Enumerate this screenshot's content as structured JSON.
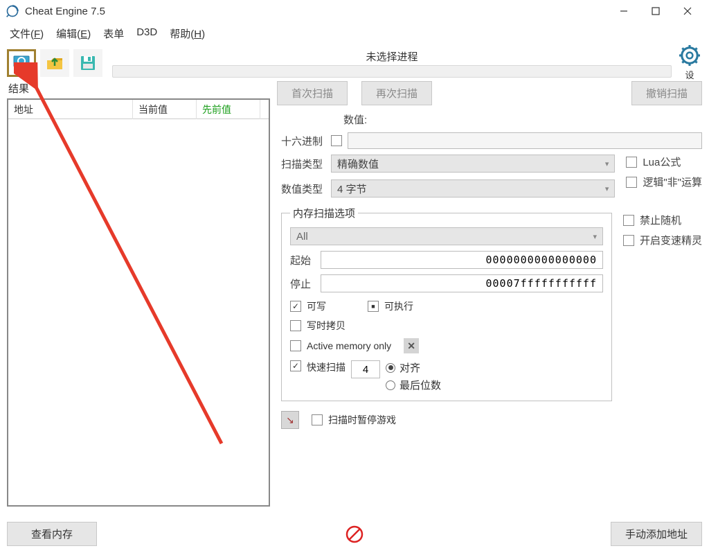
{
  "title": "Cheat Engine 7.5",
  "menu": {
    "file": "文件(F)",
    "edit": "编辑(E)",
    "table": "表单",
    "d3d": "D3D",
    "help": "帮助(H)"
  },
  "process_label": "未选择进程",
  "settings_label": "设",
  "results_label": "结果",
  "columns": {
    "address": "地址",
    "current": "当前值",
    "previous": "先前值"
  },
  "buttons": {
    "first_scan": "首次扫描",
    "next_scan": "再次扫描",
    "undo_scan": "撤销扫描",
    "view_memory": "查看内存",
    "add_manual": "手动添加地址"
  },
  "labels": {
    "value": "数值:",
    "hex": "十六进制",
    "scan_type": "扫描类型",
    "value_type": "数值类型",
    "lua_formula": "Lua公式",
    "logic_not": "逻辑\"非\"运算",
    "mem_scan_opts": "内存扫描选项",
    "start": "起始",
    "stop": "停止",
    "writable": "可写",
    "executable": "可执行",
    "copy_on_write": "写时拷贝",
    "active_mem_only": "Active memory only",
    "fast_scan": "快速扫描",
    "aligned": "对齐",
    "last_digits": "最后位数",
    "no_random": "禁止随机",
    "speedhack": "开启变速精灵",
    "pause_on_scan": "扫描时暂停游戏"
  },
  "values": {
    "scan_type_sel": "精确数值",
    "value_type_sel": "4 字节",
    "mem_region_sel": "All",
    "start_addr": "0000000000000000",
    "stop_addr": "00007fffffffffff",
    "fast_scan_qty": "4"
  }
}
